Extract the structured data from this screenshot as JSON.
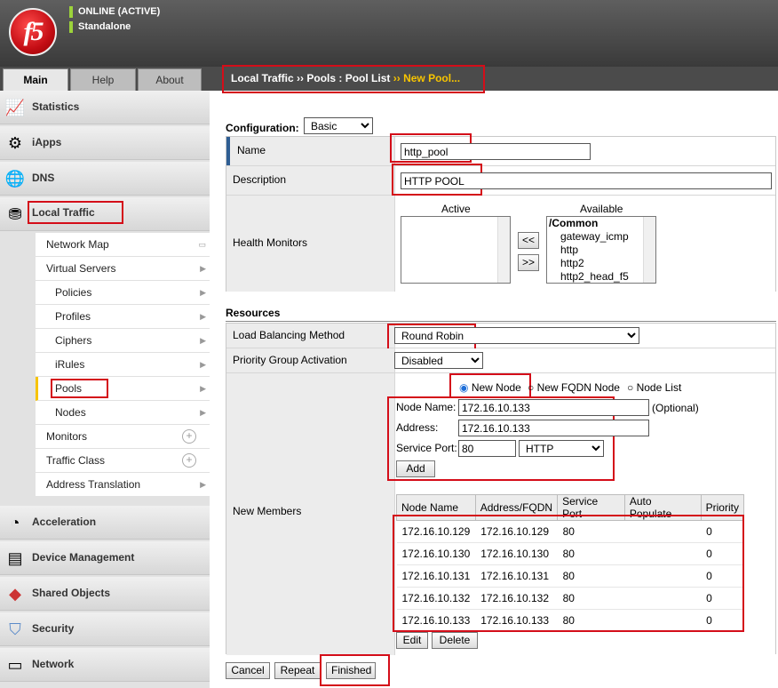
{
  "header": {
    "logo_text": "f5",
    "status": "ONLINE (ACTIVE)",
    "mode": "Standalone"
  },
  "tabs": [
    "Main",
    "Help",
    "About"
  ],
  "breadcrumb": {
    "part1": "Local Traffic",
    "sep1": "››",
    "part2": "Pools : Pool List",
    "sep2": "››",
    "current": "New Pool..."
  },
  "sidebar": {
    "sections_top": [
      {
        "label": "Statistics",
        "icon": "statistics-icon"
      },
      {
        "label": "iApps",
        "icon": "iapps-icon"
      },
      {
        "label": "DNS",
        "icon": "dns-icon"
      },
      {
        "label": "Local Traffic",
        "icon": "local-traffic-icon"
      }
    ],
    "sub": [
      "Network Map",
      "Virtual Servers",
      "Policies",
      "Profiles",
      "Ciphers",
      "iRules",
      "Pools",
      "Nodes",
      "Monitors",
      "Traffic Class",
      "Address Translation"
    ],
    "sections_bottom": [
      {
        "label": "Acceleration"
      },
      {
        "label": "Device Management"
      },
      {
        "label": "Shared Objects"
      },
      {
        "label": "Security"
      },
      {
        "label": "Network"
      }
    ]
  },
  "config": {
    "label": "Configuration:",
    "mode": "Basic"
  },
  "general": {
    "name_label": "Name",
    "name_value": "http_pool",
    "desc_label": "Description",
    "desc_value": "HTTP POOL",
    "hm_label": "Health Monitors",
    "active_label": "Active",
    "available_label": "Available",
    "add_btn": "<<",
    "remove_btn": ">>",
    "available": [
      "/Common",
      "gateway_icmp",
      "http",
      "http2",
      "http2_head_f5"
    ]
  },
  "resources": {
    "title": "Resources",
    "lb_label": "Load Balancing Method",
    "lb_value": "Round Robin",
    "pga_label": "Priority Group Activation",
    "pga_value": "Disabled",
    "nm_label": "New Members"
  },
  "new_member": {
    "opt_node": "New Node",
    "opt_fqdn": "New FQDN Node",
    "opt_list": "Node List",
    "node_name_label": "Node Name:",
    "node_name": "172.16.10.133",
    "optional": "(Optional)",
    "address_label": "Address:",
    "address": "172.16.10.133",
    "port_label": "Service Port:",
    "port": "80",
    "service": "HTTP",
    "add_btn": "Add"
  },
  "members": {
    "headers": [
      "Node Name",
      "Address/FQDN",
      "Service Port",
      "Auto Populate",
      "Priority"
    ],
    "rows": [
      [
        "172.16.10.129",
        "172.16.10.129",
        "80",
        "",
        "0"
      ],
      [
        "172.16.10.130",
        "172.16.10.130",
        "80",
        "",
        "0"
      ],
      [
        "172.16.10.131",
        "172.16.10.131",
        "80",
        "",
        "0"
      ],
      [
        "172.16.10.132",
        "172.16.10.132",
        "80",
        "",
        "0"
      ],
      [
        "172.16.10.133",
        "172.16.10.133",
        "80",
        "",
        "0"
      ]
    ],
    "edit_btn": "Edit",
    "delete_btn": "Delete"
  },
  "actions": {
    "cancel": "Cancel",
    "repeat": "Repeat",
    "finished": "Finished"
  }
}
